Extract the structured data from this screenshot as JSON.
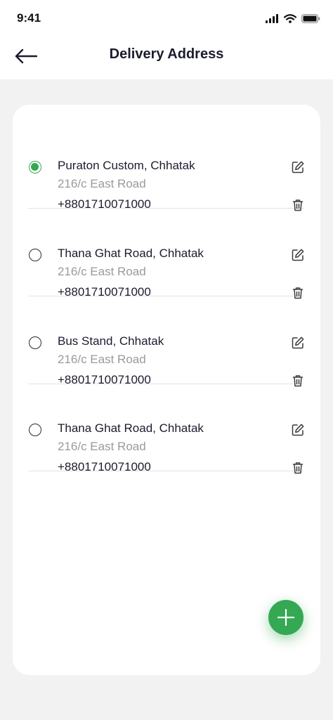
{
  "status_bar": {
    "time": "9:41",
    "icons": [
      "signal-icon",
      "wifi-icon",
      "battery-icon"
    ]
  },
  "header": {
    "title": "Delivery Address",
    "back_icon": "arrow-left-icon"
  },
  "addresses": [
    {
      "name": "Puraton Custom, Chhatak",
      "street": "216/c East Road",
      "phone": "+8801710071000",
      "selected": true
    },
    {
      "name": "Thana Ghat Road, Chhatak",
      "street": "216/c East Road",
      "phone": "+8801710071000",
      "selected": false
    },
    {
      "name": "Bus Stand, Chhatak",
      "street": "216/c East Road",
      "phone": "+8801710071000",
      "selected": false
    },
    {
      "name": "Thana Ghat Road, Chhatak",
      "street": "216/c East Road",
      "phone": "+8801710071000",
      "selected": false
    }
  ],
  "actions": {
    "edit_icon": "edit-icon",
    "delete_icon": "trash-icon",
    "add_icon": "plus-icon"
  },
  "colors": {
    "accent": "#34a853",
    "text": "#1b1c2e",
    "muted": "#9a9a9f",
    "background": "#f2f2f2"
  }
}
